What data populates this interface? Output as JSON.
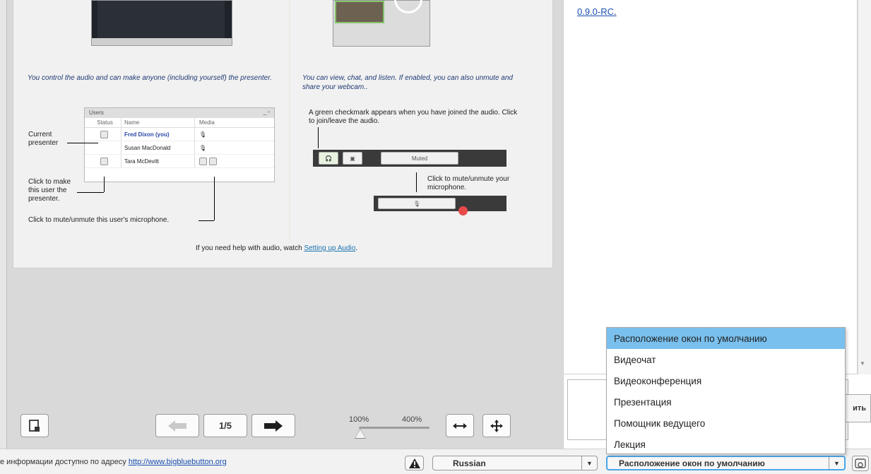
{
  "slide": {
    "left_caption": "You control the audio and can make anyone (including yourself) the presenter.",
    "right_caption": "You can view, chat, and listen.  If enabled, you can also unmute and share your webcam..",
    "users_window": {
      "title": "Users",
      "columns": [
        "Status",
        "Name",
        "Media"
      ],
      "rows": [
        {
          "name": "Fred Dixon (you)"
        },
        {
          "name": "Susan MacDonald"
        },
        {
          "name": "Tara McDevitt"
        }
      ]
    },
    "note_current_presenter": "Current presenter",
    "note_make_presenter": "Click to make this user the presenter.",
    "note_mute_user": "Click to mute/unmute this user's microphone.",
    "note_green_check": "A green checkmark appears when you have joined the audio.  Click to join/leave the audio.",
    "note_mute_mic": "Click to mute/unmute your microphone.",
    "muted_label": "Muted",
    "help_prefix": "If you need help with audio, watch ",
    "help_link": "Setting up Audio",
    "help_suffix": "."
  },
  "toolbar": {
    "page_counter": "1/5",
    "zoom_min": "100%",
    "zoom_max": "400%"
  },
  "chat": {
    "message_link": "0.9.0-RC",
    "message_suffix": ".",
    "send_label": "ить"
  },
  "footer": {
    "text_prefix": "е информации доступно по адресу ",
    "link": "http://www.bigbluebutton.org"
  },
  "language_select": {
    "value": "Russian"
  },
  "layout_select": {
    "value": "Расположение окон по умолчанию",
    "options": [
      "Расположение окон по умолчанию",
      "Видеочат",
      "Видеоконференция",
      "Презентация",
      "Помощник ведущего",
      "Лекция"
    ]
  },
  "colors": {
    "dropdown_highlight": "#79c0ee",
    "link": "#1a4fb0",
    "focus_border": "#4aa6e8"
  }
}
